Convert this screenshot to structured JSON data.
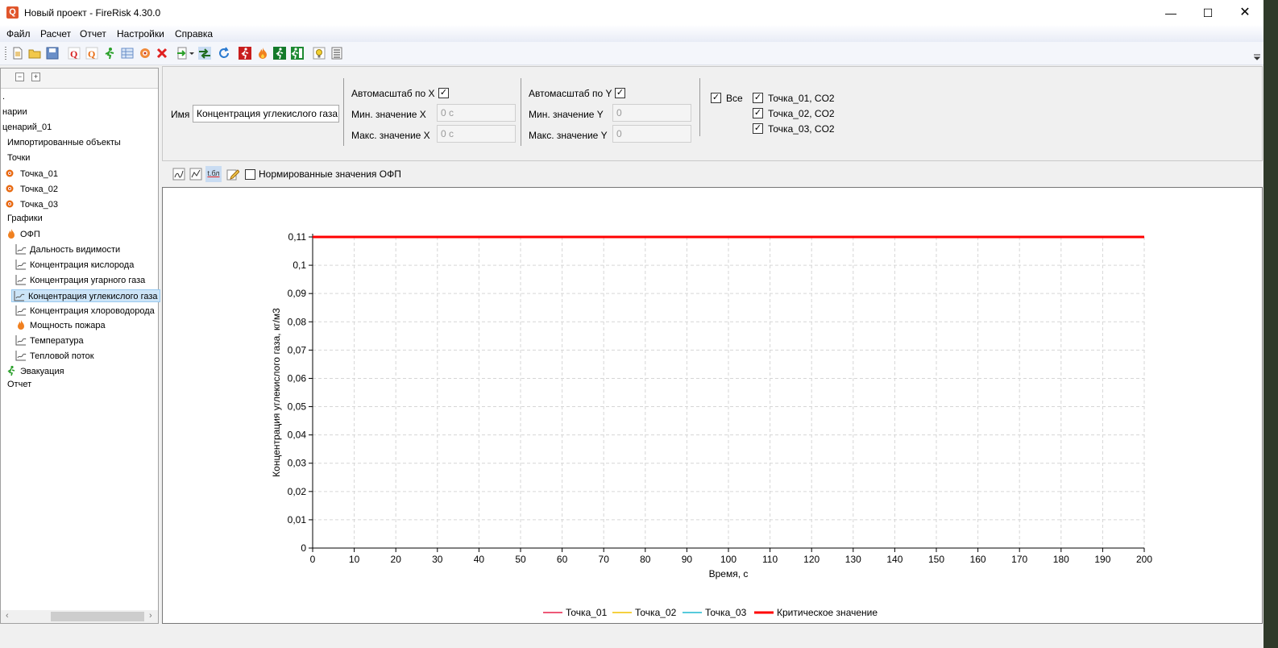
{
  "window": {
    "title": "Новый проект - FireRisk 4.30.0",
    "app_icon": "Q"
  },
  "menu": [
    "Файл",
    "Расчет",
    "Отчет",
    "Настройки",
    "Справка"
  ],
  "toolbar_icons": [
    "new-file-icon",
    "open-folder-icon",
    "save-icon",
    "q-red-icon",
    "q-orange-icon",
    "run-person-icon",
    "table-icon",
    "target-icon",
    "delete-x-icon",
    "import-arrow-icon",
    "calc-arrows-icon",
    "refresh-icon",
    "evac-red-icon",
    "fire-icon",
    "exit-green-icon",
    "exit-run-icon",
    "lamp-icon",
    "list-icon"
  ],
  "tree": {
    "collapse": "−",
    "expand": "+",
    "items": [
      {
        "label": ".",
        "icon": ""
      },
      {
        "label": "нарии",
        "icon": ""
      },
      {
        "label": "ценарий_01",
        "icon": ""
      },
      {
        "label": "Импортированные объекты",
        "icon": ""
      },
      {
        "label": "Точки",
        "icon": ""
      },
      {
        "label": "Точка_01",
        "icon": "point-icon"
      },
      {
        "label": "Точка_02",
        "icon": "point-icon"
      },
      {
        "label": "Точка_03",
        "icon": "point-icon"
      },
      {
        "label": "Графики",
        "icon": ""
      },
      {
        "label": "ОФП",
        "icon": "fire-icon"
      },
      {
        "label": "Дальность видимости",
        "icon": "vis-chart-icon"
      },
      {
        "label": "Концентрация кислорода",
        "icon": "o2-chart-icon"
      },
      {
        "label": "Концентрация угарного газа",
        "icon": "co-chart-icon"
      },
      {
        "label": "Концентрация углекислого газа",
        "icon": "co2-chart-icon",
        "selected": true
      },
      {
        "label": "Концентрация хлороводорода",
        "icon": "hcl-chart-icon"
      },
      {
        "label": "Мощность пожара",
        "icon": "fire-power-icon"
      },
      {
        "label": "Температура",
        "icon": "temperature-chart-icon"
      },
      {
        "label": "Тепловой поток",
        "icon": "heat-flow-chart-icon"
      },
      {
        "label": "Эвакуация",
        "icon": "evacuation-icon"
      },
      {
        "label": "Отчет",
        "icon": ""
      }
    ]
  },
  "controls": {
    "name_label": "Имя",
    "name_value": "Концентрация углекислого газа",
    "autoscale_x": "Автомасштаб по X",
    "min_x_label": "Мин. значение X",
    "min_x_value": "0 с",
    "max_x_label": "Макс. значение X",
    "max_x_value": "0 с",
    "autoscale_y": "Автомасштаб по Y",
    "min_y_label": "Мин. значение Y",
    "min_y_value": "0",
    "max_y_label": "Макс. значение Y",
    "max_y_value": "0",
    "all_label": "Все",
    "series_checks": [
      "Точка_01, CO2",
      "Точка_02, CO2",
      "Точка_03, CO2"
    ],
    "check_mark": "✓"
  },
  "chart_toolbar": {
    "normalized_label": "Нормированные значения ОФП",
    "table_icon_text": "t.бл"
  },
  "chart_data": {
    "type": "line",
    "xlabel": "Время, с",
    "ylabel": "Концентрация углекислого газа, кг/м3",
    "xlim": [
      0,
      200
    ],
    "ylim": [
      0,
      0.11
    ],
    "x_ticks": [
      "0",
      "10",
      "20",
      "30",
      "40",
      "50",
      "60",
      "70",
      "80",
      "90",
      "100",
      "110",
      "120",
      "130",
      "140",
      "150",
      "160",
      "170",
      "180",
      "190",
      "200"
    ],
    "y_ticks": [
      "0",
      "0,01",
      "0,02",
      "0,03",
      "0,04",
      "0,05",
      "0,06",
      "0,07",
      "0,08",
      "0,09",
      "0,1",
      "0,11"
    ],
    "grid": true,
    "legend_position": "bottom",
    "series": [
      {
        "name": "Точка_01",
        "color": "#e8204a",
        "x": [],
        "y": []
      },
      {
        "name": "Точка_02",
        "color": "#f2c200",
        "x": [],
        "y": []
      },
      {
        "name": "Точка_03",
        "color": "#1fb8d0",
        "x": [],
        "y": []
      },
      {
        "name": "Критическое значение",
        "color": "#ff0000",
        "x": [
          0,
          200
        ],
        "y": [
          0.11,
          0.11
        ]
      }
    ]
  }
}
